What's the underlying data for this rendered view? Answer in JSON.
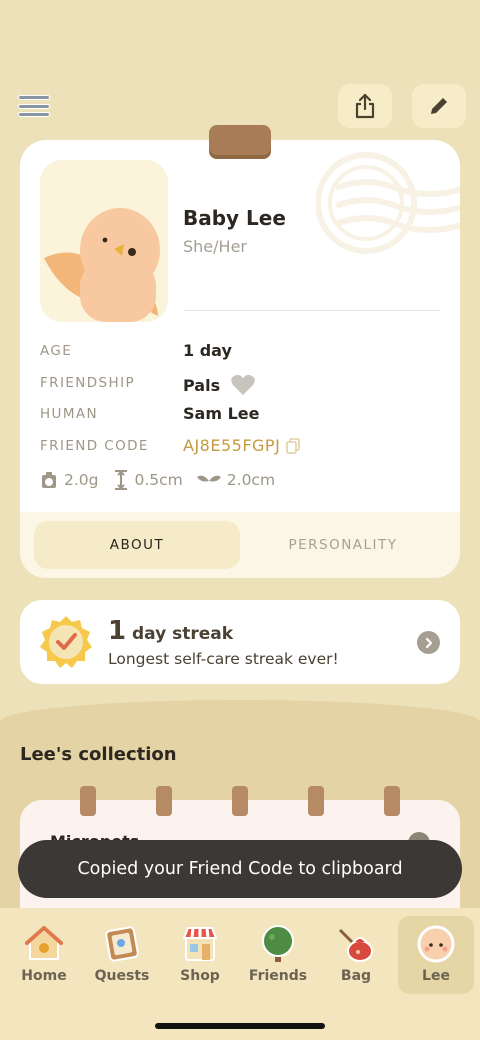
{
  "header": {
    "menu_icon": "hamburger-icon",
    "share_icon": "share-icon",
    "edit_icon": "pencil-icon"
  },
  "profile": {
    "name": "Baby Lee",
    "pronouns": "She/Her",
    "rows": {
      "age": {
        "label": "AGE",
        "value": "1 day"
      },
      "friendship": {
        "label": "FRIENDSHIP",
        "value": "Pals"
      },
      "human": {
        "label": "HUMAN",
        "value": "Sam Lee"
      },
      "friend_code": {
        "label": "FRIEND CODE",
        "value": "AJ8E55FGPJ"
      }
    },
    "stats": {
      "weight": "2.0g",
      "height": "0.5cm",
      "wingspan": "2.0cm"
    },
    "tabs": {
      "about": "ABOUT",
      "personality": "PERSONALITY"
    }
  },
  "streak": {
    "count": "1",
    "title_suffix": "day streak",
    "subtitle": "Longest self-care streak ever!"
  },
  "collection": {
    "title": "Lee's collection",
    "card_title": "Micropets"
  },
  "toast": {
    "message": "Copied your Friend Code to clipboard"
  },
  "nav": {
    "home": "Home",
    "quests": "Quests",
    "shop": "Shop",
    "friends": "Friends",
    "bag": "Bag",
    "lee": "Lee",
    "active": "Lee"
  },
  "colors": {
    "background": "#ece1b9",
    "accent_gold": "#c49a3e",
    "toast_bg": "#3b3835"
  }
}
